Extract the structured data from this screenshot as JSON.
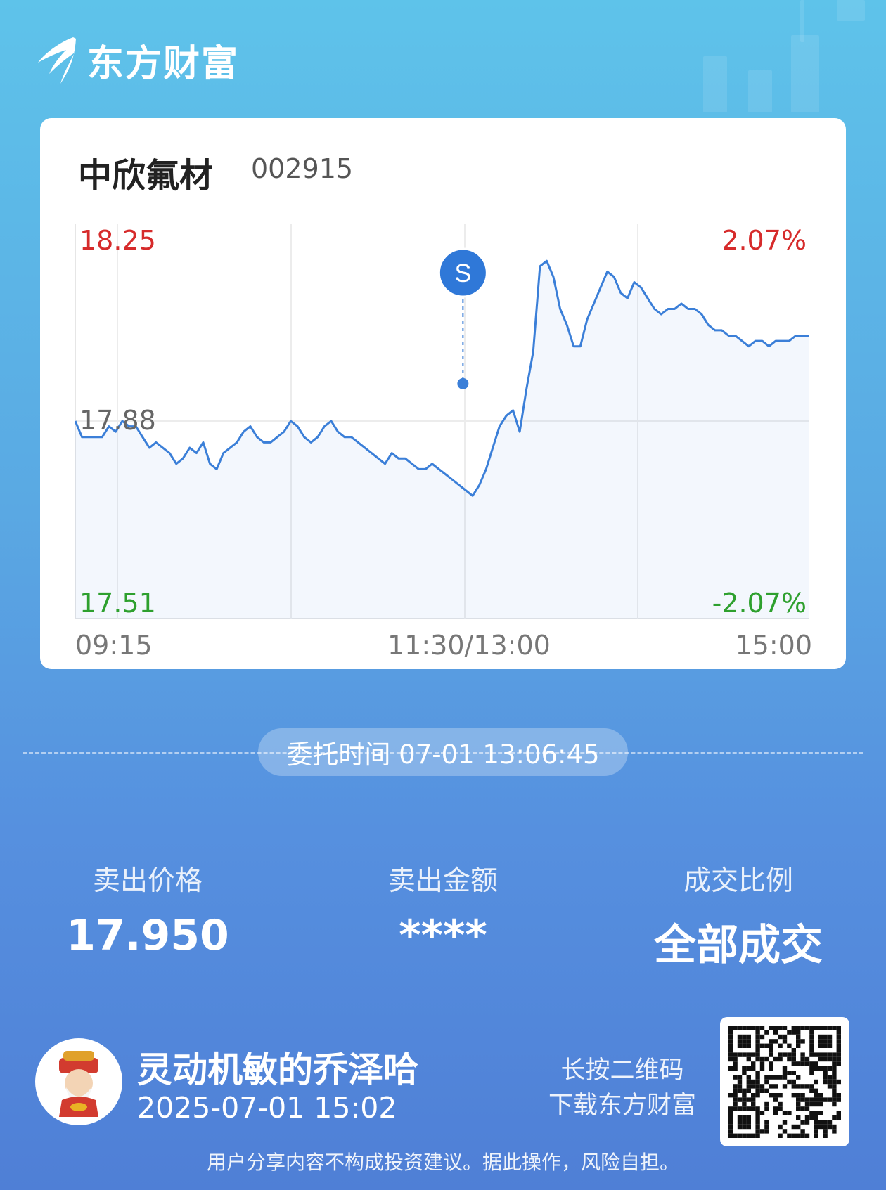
{
  "brand": {
    "name": "东方财富"
  },
  "stock": {
    "name": "中欣氟材",
    "code": "002915"
  },
  "chart_data": {
    "type": "line",
    "title": "",
    "xlabel": "",
    "ylabel": "",
    "x_ticks": [
      "09:15",
      "11:30/13:00",
      "15:00"
    ],
    "y_left_ticks": [
      "18.25",
      "17.88",
      "17.51"
    ],
    "y_right_ticks": [
      "2.07%",
      "-2.07%"
    ],
    "ylim": [
      17.51,
      18.25
    ],
    "reference_price": 17.88,
    "series": [
      {
        "values": [
          17.88,
          17.85,
          17.85,
          17.85,
          17.85,
          17.87,
          17.86,
          17.88,
          17.87,
          17.87,
          17.85,
          17.83,
          17.84,
          17.83,
          17.82,
          17.8,
          17.81,
          17.83,
          17.82,
          17.84,
          17.8,
          17.79,
          17.82,
          17.83,
          17.84,
          17.86,
          17.87,
          17.85,
          17.84,
          17.84,
          17.85,
          17.86,
          17.88,
          17.87,
          17.85,
          17.84,
          17.85,
          17.87,
          17.88,
          17.86,
          17.85,
          17.85,
          17.84,
          17.83,
          17.82,
          17.81,
          17.8,
          17.82,
          17.81,
          17.81,
          17.8,
          17.79,
          17.79,
          17.8,
          17.79,
          17.78,
          17.77,
          17.76,
          17.75,
          17.74,
          17.76,
          17.79,
          17.83,
          17.87,
          17.89,
          17.9,
          17.86,
          17.94,
          18.01,
          18.17,
          18.18,
          18.15,
          18.09,
          18.06,
          18.02,
          18.02,
          18.07,
          18.1,
          18.13,
          18.16,
          18.15,
          18.12,
          18.11,
          18.14,
          18.13,
          18.11,
          18.09,
          18.08,
          18.09,
          18.09,
          18.1,
          18.09,
          18.09,
          18.08,
          18.06,
          18.05,
          18.05,
          18.04,
          18.04,
          18.03,
          18.02,
          18.03,
          18.03,
          18.02,
          18.03,
          18.03,
          18.03,
          18.04,
          18.04,
          18.04
        ]
      }
    ],
    "sell_marker": {
      "label": "S",
      "time": "13:06:45",
      "price": 17.95
    }
  },
  "order": {
    "time_label": "委托时间 07-01 13:06:45"
  },
  "stats": [
    {
      "label": "卖出价格",
      "value": "17.950"
    },
    {
      "label": "卖出金额",
      "value": "****"
    },
    {
      "label": "成交比例",
      "value": "全部成交"
    }
  ],
  "user": {
    "name": "灵动机敏的乔泽哈",
    "time": "2025-07-01 15:02"
  },
  "qr": {
    "hint_line1": "长按二维码",
    "hint_line2": "下载东方财富"
  },
  "footer": {
    "disclaimer": "用户分享内容不构成投资建议。据此操作，风险自担。"
  },
  "colors": {
    "up": "#d62b2b",
    "down": "#2ea02e",
    "line": "#3b7fd8",
    "neutral": "#666666"
  }
}
